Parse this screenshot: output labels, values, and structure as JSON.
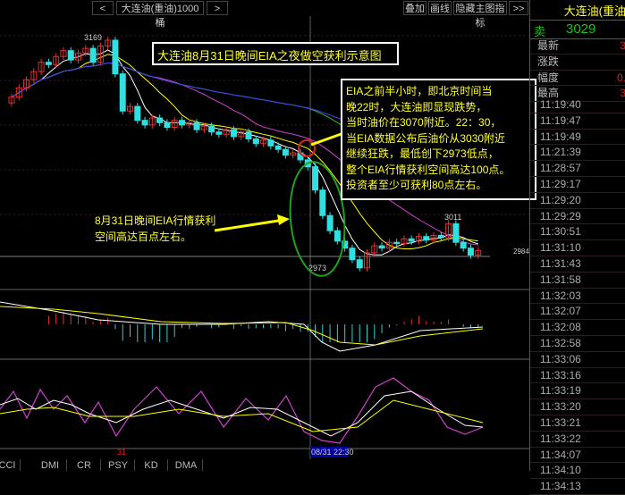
{
  "toolbar": {
    "prev": "<",
    "symbol": "大连油(重油)1000桶",
    "next": ">",
    "overlay": "叠加",
    "draw": "画线",
    "hide_indicators": "隐藏主图指标",
    "more": ">>"
  },
  "quote": {
    "title": "大连油(重油",
    "sell_label": "卖",
    "sell_value": "3029",
    "rows": [
      {
        "label": "最新",
        "value": "3"
      },
      {
        "label": "涨跌",
        "value": ""
      },
      {
        "label": "幅度",
        "value": "0."
      },
      {
        "label": "最高",
        "value": "3"
      }
    ]
  },
  "ticks": [
    "11:19:40",
    "11:19:47",
    "11:19:49",
    "11:21:39",
    "11:28:57",
    "11:29:17",
    "11:29:20",
    "11:29:29",
    "11:30:51",
    "11:31:10",
    "11:31:43",
    "11:31:58",
    "11:32:03",
    "11:32:07",
    "11:32:08",
    "11:32:58",
    "11:33:06",
    "11:33:16",
    "11:33:19",
    "11:33:20",
    "11:33:21",
    "11:33:22",
    "11:34:07",
    "11:34:10",
    "11:34:13"
  ],
  "annotations": {
    "title": "大连油8月31日晚间EIA之夜做空获利示意图",
    "left_note": [
      "8月31日晚间EIA行情获利",
      "空间高达百点左右。"
    ],
    "right_note": [
      "EIA之前半小时，即北京时间当",
      "晚22时，大连油即显现跌势，",
      "当时油价在3070附近。22：30，",
      "当EIA数据公布后油价从3030附近",
      "继续狂跌，最低创下2973低点，",
      "整个EIA行情获利空间高达100点。",
      "投资者至少可获利80点左右。"
    ]
  },
  "chart_data": {
    "type": "candlestick",
    "high_label": "3169",
    "low_label": "2973",
    "peak2_label": "3011",
    "last_label": "2984",
    "closes": [
      3120,
      3128,
      3135,
      3142,
      3150,
      3148,
      3155,
      3160,
      3152,
      3158,
      3162,
      3150,
      3164,
      3169,
      3140,
      3108,
      3112,
      3100,
      3096,
      3102,
      3098,
      3094,
      3100,
      3096,
      3098,
      3092,
      3095,
      3090,
      3088,
      3092,
      3086,
      3090,
      3084,
      3080,
      3083,
      3078,
      3075,
      3070,
      3072,
      3066,
      3060,
      3040,
      3018,
      3005,
      2996,
      2990,
      2980,
      2973,
      2986,
      2992,
      2990,
      2995,
      2994,
      2998,
      2996,
      3000,
      2997,
      3001,
      2999,
      3011,
      2995,
      2990,
      2984,
      2988
    ],
    "date_label": "31",
    "cursor_time": "08/31 22:30"
  },
  "tabs": [
    "CCI",
    "DMI",
    "CR",
    "PSY",
    "KD",
    "DMA"
  ]
}
